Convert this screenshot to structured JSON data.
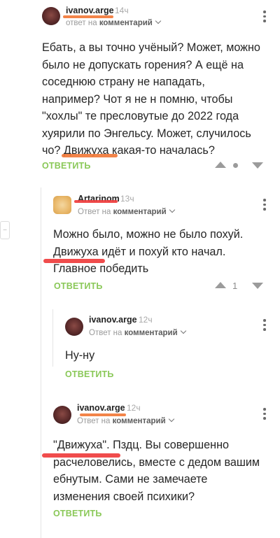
{
  "comments": [
    {
      "username": "ivanov.arge",
      "time": "14ч",
      "reply_prefix": "ответ на",
      "reply_target": "комментарий",
      "text": "Ебать, а вы точно учёный? Может, можно было не допускать горения? А ещё на соседнюю страну не нападать, например? Чот я не н помню, чтобы \"хохлы\" те пресловутые до 2022 года хуярили по Энгельсу. Может, случилось чо? Движуха какая-то началась?",
      "reply_label": "ОТВЕТИТЬ",
      "rating": ""
    },
    {
      "username": "Artarinom",
      "time": "13ч",
      "reply_prefix": "Ответ на",
      "reply_target": "комментарий",
      "text": "Можно было, можно не было похуй. Движуха идёт и похуй кто начал. Главное победить",
      "reply_label": "ОТВЕТИТЬ",
      "rating": "1"
    },
    {
      "username": "ivanov.arge",
      "time": "12ч",
      "reply_prefix": "Ответ на",
      "reply_target": "комментарий",
      "text": "Ну-ну",
      "reply_label": "ОТВЕТИТЬ",
      "rating": ""
    },
    {
      "username": "ivanov.arge",
      "time": "12ч",
      "reply_prefix": "Ответ на",
      "reply_target": "комментарий",
      "text": "\"Движуха\". Пздц. Вы совершенно расчеловелись, вместе с дедом вашим ебнутым. Сами не замечаете изменения своей психики?",
      "reply_label": "ОТВЕТИТЬ",
      "rating": ""
    }
  ],
  "collapse_label": "−",
  "colors": {
    "reply_green": "#8ac858",
    "marker_red": "#ef3d3d",
    "marker_orange": "#f27a3a"
  }
}
